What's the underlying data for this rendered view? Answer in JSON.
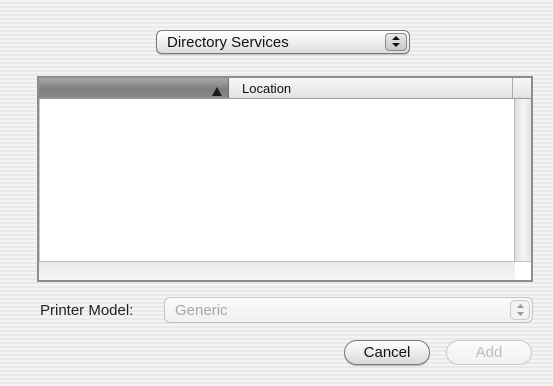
{
  "source_popup": {
    "selected": "Directory Services"
  },
  "printer_list": {
    "columns": [
      {
        "label": "",
        "sorted": true,
        "sort_direction": "ascending"
      },
      {
        "label": "Location"
      }
    ],
    "rows": []
  },
  "printer_model": {
    "label": "Printer Model:",
    "selected": "Generic",
    "enabled": false
  },
  "buttons": {
    "cancel": "Cancel",
    "add": "Add",
    "add_enabled": false
  }
}
